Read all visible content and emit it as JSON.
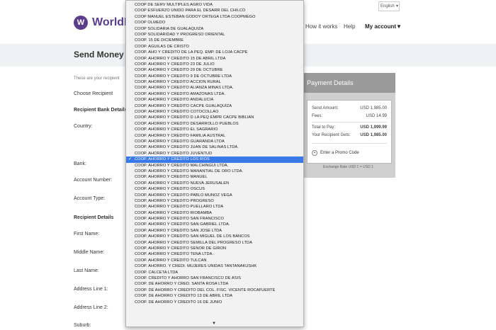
{
  "header": {
    "logo_mark": "W",
    "logo_text": "WorldRe",
    "language": "English",
    "nav": {
      "how_it_works": "How it works",
      "help": "Help",
      "account": "My account▼"
    }
  },
  "banner": {
    "title": "Send Money"
  },
  "form": {
    "intro": "These are your recipient",
    "choose_recipient": "Choose Recipient",
    "bank_details": "Recipient Bank Details",
    "country": "Country:",
    "bank": "Bank:",
    "account_number": "Account Number:",
    "account_type": "Account Type:",
    "recipient_details": "Recipient Details",
    "first_name": "First Name:",
    "middle_name": "Middle Name:",
    "last_name": "Last Name:",
    "address1": "Address Line 1:",
    "address2": "Address Line 2:",
    "suburb": "Suburb:"
  },
  "payment": {
    "title": "Payment Details",
    "send_amount_label": "Send Amount:",
    "send_amount": "USD 1,985.00",
    "fees_label": "Fees:",
    "fees": "USD 14.99",
    "total_label": "Total to Pay:",
    "total": "USD 1,999.99",
    "gets_label": "Your Recipient Gets:",
    "gets": "USD 1,985.00",
    "promo": "Enter a Promo Code",
    "exchange": "Exchange Rate USD 1 = USD 1"
  },
  "dropdown": {
    "selected_index": 26,
    "options": [
      "COOP DE SERV MULTIPLES AGRO VIDA",
      "COOP ESFUERZO UNIDO PARA EL DESARR DEL CHILCO",
      "COOP MANUEL ESTEBAN GODOY ORTEGA LTDA COOPMEGO",
      "COOP OLMEDO",
      "COOP SOLIDARIA DE GUALAQUIZA",
      "COOP SOLIDARIDAD Y PROGRESO ORIENTAL",
      "COOP. 15 DE DICIEMBRE",
      "COOP. AGUILAS DE CRISTO",
      "COOP. AHO Y CREDITO DE LA PEQ. EMP. DE LOJA CACPE",
      "COOP. AHORRO Y CREDITO 15 DE ABRIL LTDA",
      "COOP. AHORRO Y CREDITO 23 DE JULIO",
      "COOP. AHORRO Y CREDITO 29 DE OCTUBRE",
      "COOP. AHORRO Y CREDITO 9 DE OCTUBRE LTDA",
      "COOP. AHORRO Y CREDITO ACCION RURAL",
      "COOP. AHORRO Y CREDITO ALIANZA MINAS LTDA.",
      "COOP. AHORRO Y CREDITO AMAZONAS LTDA.",
      "COOP. AHORRO Y CREDITO ANDALUCIA",
      "COOP. AHORRO Y CREDITO CACPE GUALAQUIZA",
      "COOP. AHORRO Y CREDITO COTOCOLLAO",
      "COOP. AHORRO Y CREDITO D LA PEQ EMPR CACPE BIBLIAN",
      "COOP. AHORRO Y CREDITO DESARROLLO PUEBLOS",
      "COOP. AHORRO Y CREDITO EL SAGRARIO",
      "COOP. AHORRO Y CREDITO FAMILIA AUSTRAL",
      "COOP. AHORRO Y CREDITO GUARANDA LTDA",
      "COOP. AHORRO Y CREDITO JUAN DE SALINAS LTDA.",
      "COOP. AHORRO Y CREDITO JUVENTUD",
      "COOP. AHORRO Y CREDITO LOS RIOS",
      "COOP. AHORRO Y CREDITO MALCHINGUI LTDA.",
      "COOP. AHORRO Y CREDITO MANANTIAL DE ORO LTDA.",
      "COOP. AHORRO Y CREDITO MANUEL",
      "COOP. AHORRO Y CREDITO NUEVA JERUSALEN",
      "COOP. AHORRO Y CREDITO OSCUS",
      "COOP. AHORRO Y CREDITO PABLO MUNOZ VEGA",
      "COOP. AHORRO Y CREDITO PROGRESO",
      "COOP. AHORRO Y CREDITO PUELLARO LTDA",
      "COOP. AHORRO Y CREDITO RIOBAMBA",
      "COOP. AHORRO Y CREDITO SAN FRANCISCO",
      "COOP. AHORRO Y CREDITO SAN GABRIEL LTDA.",
      "COOP. AHORRO Y CREDITO SAN JOSE LTDA",
      "COOP. AHORRO Y CREDITO SAN MIGUEL DE LOS BANCOS",
      "COOP. AHORRO Y CREDITO SEMILLA DEL PROGRESO LTDA",
      "COOP. AHORRO Y CREDITO SENOR DE GIRON",
      "COOP. AHORRO Y CREDITO TENA LTDA.",
      "COOP. AHORRO Y CREDITO TULCAN",
      "COOP. AHORRO. Y CREDI. MUJERES UNIDAS TANTANAKUSHK",
      "COOP. CALCETA LTDA",
      "COOP. CREDITO Y AHORRO SAN FRANCISCO DE ASIS",
      "COOP. DE AHORRO Y CRED. SANTA ROSA LTDA",
      "COOP. DE AHORRO Y CREDITO DEL COL. FISC. VICENTE ROCAFUERTE",
      "COOP. DE AHORRO Y CREDITO 13 DE ABRIL LTDA",
      "COOP. DE AHORRO Y CREDITO 16 DE JUNIO"
    ],
    "check_glyph": "✓",
    "scroll_glyph": "▼"
  }
}
